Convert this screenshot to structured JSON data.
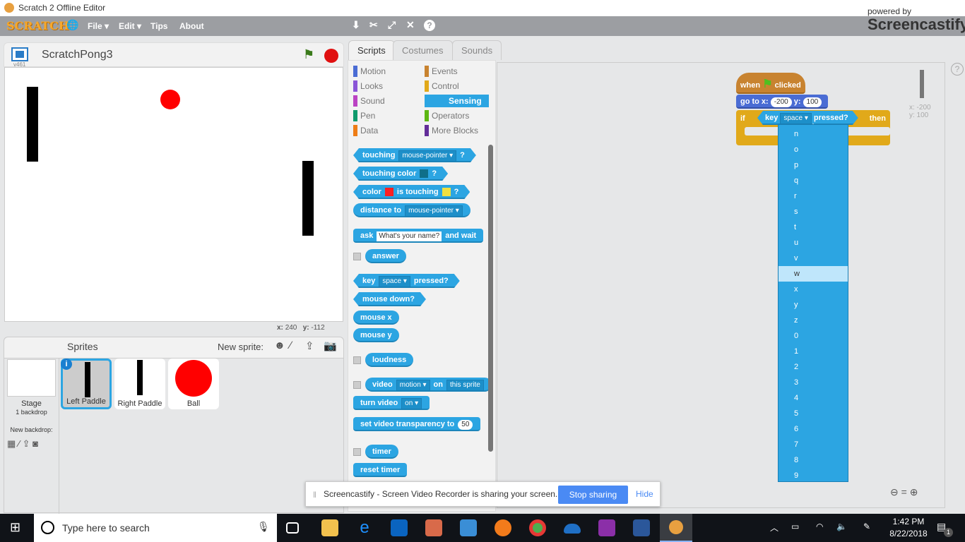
{
  "window": {
    "title": "Scratch 2 Offline Editor"
  },
  "menu": {
    "logo": "SCRATCH",
    "file": "File ▾",
    "edit": "Edit ▾",
    "tips": "Tips",
    "about": "About"
  },
  "watermark": {
    "powered": "powered by",
    "brand": "Screencastify"
  },
  "stage": {
    "project_name": "ScratchPong3",
    "version": "v461",
    "mouse_x_label": "x:",
    "mouse_x": "240",
    "mouse_y_label": "y:",
    "mouse_y": "-112"
  },
  "tabs": [
    "Scripts",
    "Costumes",
    "Sounds"
  ],
  "categories": [
    {
      "label": "Motion",
      "color": "#4a6cd4"
    },
    {
      "label": "Events",
      "color": "#c88330"
    },
    {
      "label": "Looks",
      "color": "#8a55d7"
    },
    {
      "label": "Control",
      "color": "#e1a91a"
    },
    {
      "label": "Sound",
      "color": "#bb42c3"
    },
    {
      "label": "Sensing",
      "color": "#2ca5e2",
      "selected": true
    },
    {
      "label": "Pen",
      "color": "#0e9a6c"
    },
    {
      "label": "Operators",
      "color": "#5cb712"
    },
    {
      "label": "Data",
      "color": "#ee7d16"
    },
    {
      "label": "More Blocks",
      "color": "#632d99"
    }
  ],
  "palette_blocks": [
    {
      "shape": "hex",
      "parts": [
        {
          "t": "touching"
        },
        {
          "f": "mouse-pointer ▾"
        },
        {
          "t": "?"
        }
      ]
    },
    {
      "shape": "hex",
      "parts": [
        {
          "t": "touching color"
        },
        {
          "c": "#0f6f8a"
        },
        {
          "t": "?"
        }
      ]
    },
    {
      "shape": "hex",
      "parts": [
        {
          "t": "color"
        },
        {
          "c": "#ff2020"
        },
        {
          "t": "is touching"
        },
        {
          "c": "#f0e040"
        },
        {
          "t": "?"
        }
      ]
    },
    {
      "shape": "rep",
      "parts": [
        {
          "t": "distance to"
        },
        {
          "f": "mouse-pointer ▾"
        }
      ]
    },
    {
      "shape": "stack",
      "parts": [
        {
          "t": "ask"
        },
        {
          "s": "What's your name?"
        },
        {
          "t": "and wait"
        }
      ]
    },
    {
      "shape": "rep",
      "check": true,
      "parts": [
        {
          "t": "answer"
        }
      ]
    },
    {
      "shape": "hex",
      "parts": [
        {
          "t": "key"
        },
        {
          "f": "space ▾"
        },
        {
          "t": "pressed?"
        }
      ]
    },
    {
      "shape": "hex",
      "parts": [
        {
          "t": "mouse down?"
        }
      ]
    },
    {
      "shape": "rep",
      "parts": [
        {
          "t": "mouse x"
        }
      ]
    },
    {
      "shape": "rep",
      "parts": [
        {
          "t": "mouse y"
        }
      ]
    },
    {
      "shape": "rep",
      "check": true,
      "parts": [
        {
          "t": "loudness"
        }
      ]
    },
    {
      "shape": "rep",
      "check": true,
      "parts": [
        {
          "t": "video"
        },
        {
          "f": "motion ▾"
        },
        {
          "t": "on"
        },
        {
          "f": "this sprite"
        }
      ]
    },
    {
      "shape": "stack",
      "parts": [
        {
          "t": "turn video"
        },
        {
          "f": "on ▾"
        }
      ]
    },
    {
      "shape": "stack",
      "parts": [
        {
          "t": "set video transparency to"
        },
        {
          "n": "50"
        }
      ]
    },
    {
      "shape": "rep",
      "check": true,
      "parts": [
        {
          "t": "timer"
        }
      ]
    },
    {
      "shape": "stack",
      "parts": [
        {
          "t": "reset timer"
        }
      ]
    }
  ],
  "script": {
    "hat_when": "when",
    "hat_clicked": "clicked",
    "goto": "go to x:",
    "goto_x": "-200",
    "goto_y_label": "y:",
    "goto_y": "100",
    "if": "if",
    "key": "key",
    "key_value": "space ▾",
    "pressed": "pressed?",
    "then": "then"
  },
  "sprite_info": {
    "x": "x: -200",
    "y": "y: 100"
  },
  "key_dropdown": {
    "options": [
      "n",
      "o",
      "p",
      "q",
      "r",
      "s",
      "t",
      "u",
      "v",
      "w",
      "x",
      "y",
      "z",
      "0",
      "1",
      "2",
      "3",
      "4",
      "5",
      "6",
      "7",
      "8",
      "9"
    ],
    "highlighted": "w"
  },
  "sprites_pane": {
    "title": "Sprites",
    "new_sprite": "New sprite:",
    "stage_label": "Stage",
    "stage_sub": "1 backdrop",
    "new_backdrop": "New backdrop:",
    "sprites": [
      {
        "name": "Left Paddle",
        "selected": true
      },
      {
        "name": "Right Paddle"
      },
      {
        "name": "Ball"
      }
    ]
  },
  "share_bar": {
    "message": "Screencastify - Screen Video Recorder is sharing your screen.",
    "stop": "Stop sharing",
    "hide": "Hide"
  },
  "taskbar": {
    "search_placeholder": "Type here to search",
    "time": "1:42 PM",
    "date": "8/22/2018",
    "notifications": "1"
  }
}
